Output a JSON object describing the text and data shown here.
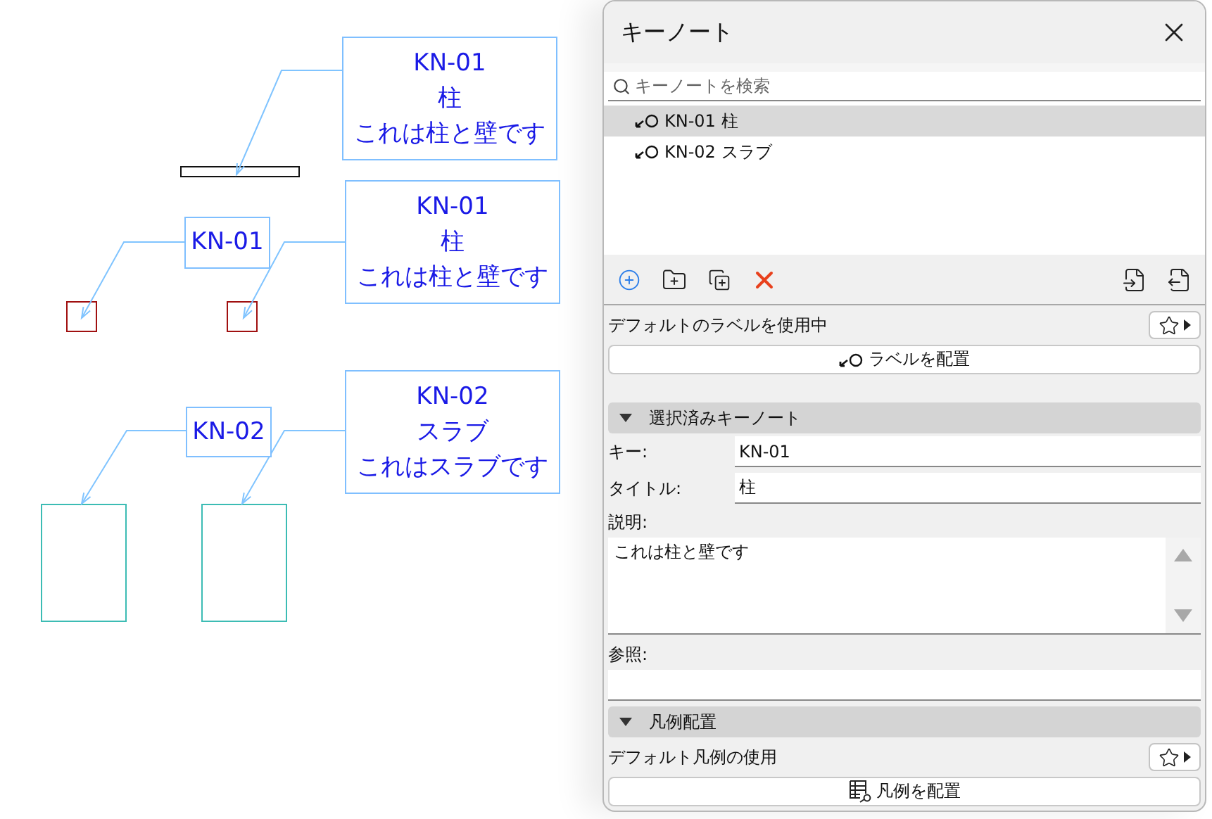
{
  "canvas": {
    "labels": [
      {
        "lines": [
          "KN-01",
          "柱",
          "これは柱と壁です"
        ]
      },
      {
        "lines": [
          "KN-01"
        ]
      },
      {
        "lines": [
          "KN-01",
          "柱",
          "これは柱と壁です"
        ]
      },
      {
        "lines": [
          "KN-02"
        ]
      },
      {
        "lines": [
          "KN-02",
          "スラブ",
          "これはスラブです"
        ]
      }
    ]
  },
  "panel": {
    "title": "キーノート",
    "search": {
      "placeholder": "キーノートを検索"
    },
    "keynotes": [
      {
        "text": "KN-01 柱",
        "selected": true
      },
      {
        "text": "KN-02 スラブ",
        "selected": false
      }
    ],
    "label_status": "デフォルトのラベルを使用中",
    "label_button": "ラベルを配置",
    "selected_section": {
      "title": "選択済みキーノート",
      "expanded": true,
      "fields": [
        {
          "label": "キー:",
          "value": "KN-01"
        },
        {
          "label": "タイトル:",
          "value": "柱"
        }
      ],
      "description_label": "説明:",
      "description": "これは柱と壁です",
      "reference_label": "参照:"
    },
    "legend_section": {
      "title": "凡例配置",
      "expanded": true,
      "status": "デフォルト凡例の使用",
      "button": "凡例を配置"
    }
  }
}
